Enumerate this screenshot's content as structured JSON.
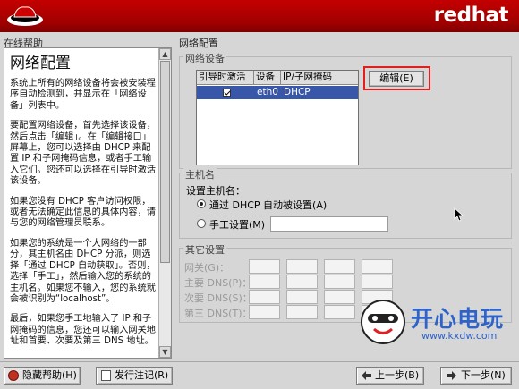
{
  "header": {
    "brand": "redhat"
  },
  "help": {
    "section_label": "在线帮助",
    "heading": "网络配置",
    "paragraphs": [
      "系统上所有的网络设备将会被安装程序自动检测到，并显示在「网络设备」列表中。",
      "要配置网络设备，首先选择该设备，然后点击「编辑」。在「编辑接口」屏幕上，您可以选择由 DHCP 来配置 IP 和子网掩码信息，或者手工输入它们。您还可以选择在引导时激活该设备。",
      "如果您没有 DHCP 客户访问权限，或者无法确定此信息的具体内容，请与您的网络管理员联系。",
      "如果您的系统是一个大网络的一部分，其主机名由 DHCP 分派，则选择「通过 DHCP 自动获取」。否则，选择「手工」，然后输入您的系统的主机名。如果您不输入，您的系统就会被识别为“localhost”。",
      "最后，如果您手工地输入了 IP 和子网掩码的信息，您还可以输入网关地址和首要、次要及第三 DNS 地址。"
    ]
  },
  "network": {
    "title": "网络配置",
    "devices_label": "网络设备",
    "columns": [
      "引导时激活",
      "设备",
      "IP/子网掩码"
    ],
    "rows": [
      {
        "active": true,
        "device": "eth0",
        "ip": "DHCP"
      }
    ],
    "edit_button": "编辑(E)"
  },
  "hostname": {
    "section_label": "主机名",
    "set_label": "设置主机名：",
    "dhcp_option": "通过 DHCP 自动被设置(A)",
    "manual_option": "手工设置(M)",
    "selected": "dhcp",
    "manual_value": ""
  },
  "misc": {
    "section_label": "其它设置",
    "fields": [
      {
        "label": "网关(G)："
      },
      {
        "label": "主要 DNS(P)："
      },
      {
        "label": "次要 DNS(S)："
      },
      {
        "label": "第三 DNS(T)："
      }
    ]
  },
  "buttons": {
    "hide_help": "隐藏帮助(H)",
    "release_notes": "发行注记(R)",
    "back": "上一步(B)",
    "next": "下一步(N)"
  },
  "watermark": {
    "main": "开心电玩",
    "url": "www.kxdw.com"
  },
  "colors": {
    "header": "#b30000",
    "selection": "#3957a9",
    "highlight": "#e02020"
  }
}
